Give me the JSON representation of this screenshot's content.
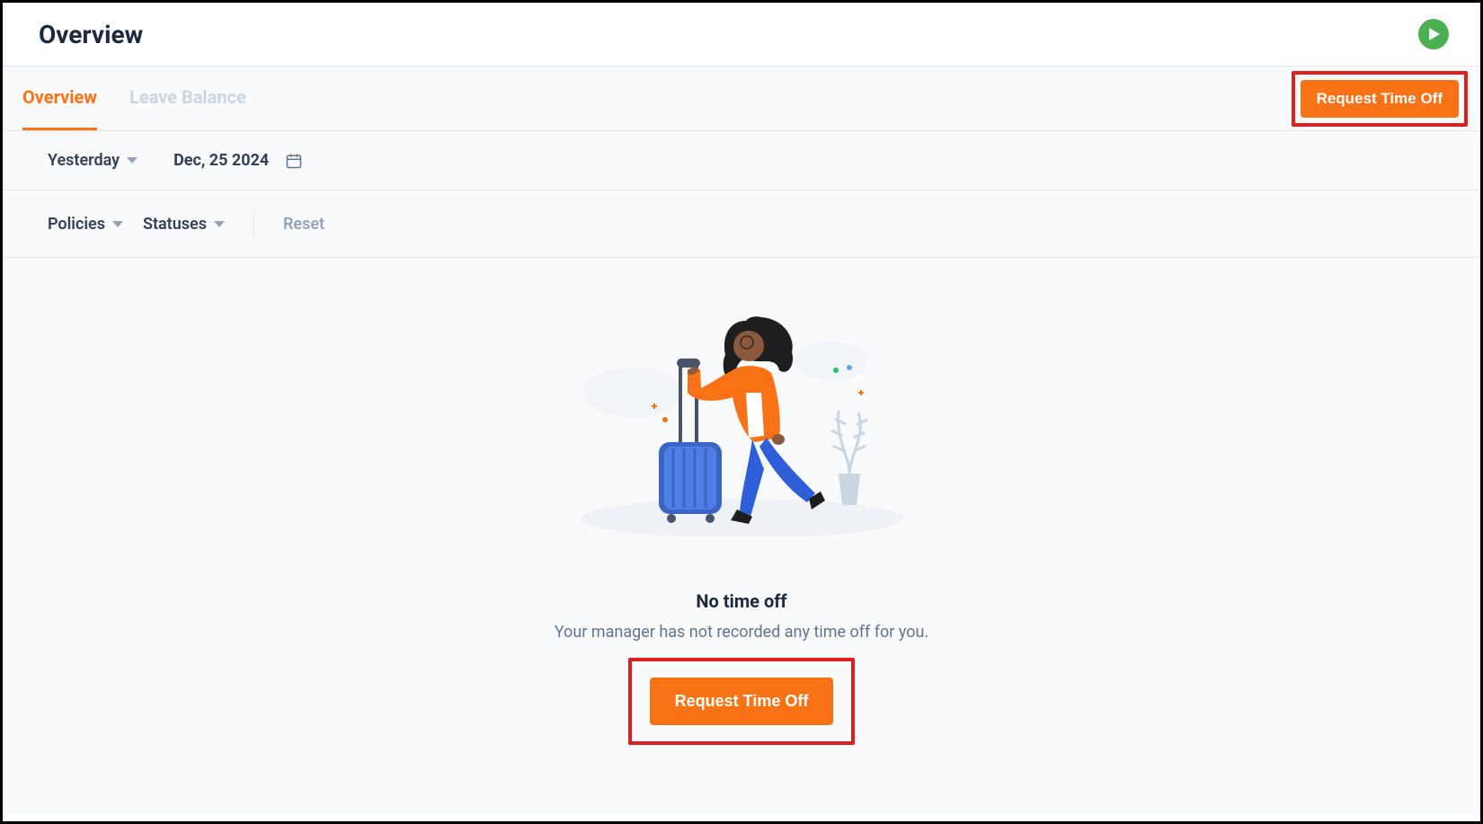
{
  "header": {
    "title": "Overview",
    "play_icon": "play-icon"
  },
  "tabs": {
    "overview": "Overview",
    "leave_balance": "Leave Balance"
  },
  "actions": {
    "request_top": "Request Time Off",
    "request_mid": "Request Time Off"
  },
  "date": {
    "range_label": "Yesterday",
    "value": "Dec, 25 2024"
  },
  "filters": {
    "policies": "Policies",
    "statuses": "Statuses",
    "reset": "Reset"
  },
  "empty": {
    "title": "No time off",
    "subtitle": "Your manager has not recorded any time off for you."
  },
  "colors": {
    "accent": "#f97316",
    "highlight": "#e11d1d",
    "play": "#4caf50"
  }
}
